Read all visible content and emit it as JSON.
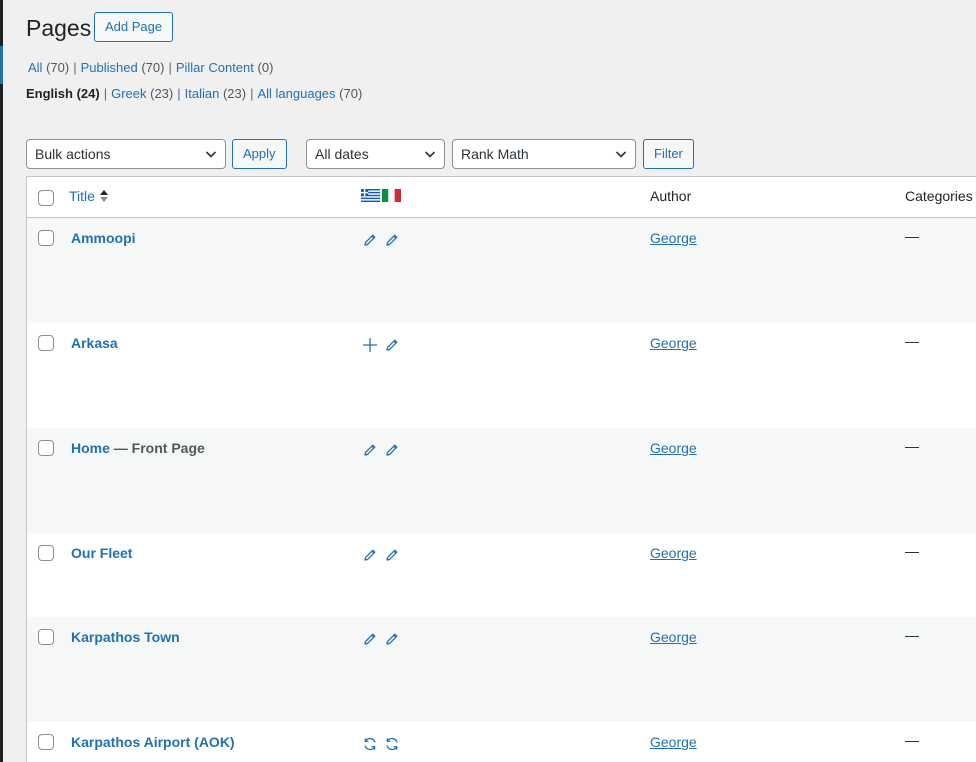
{
  "header": {
    "title": "Pages",
    "add_button": "Add Page"
  },
  "status_links": [
    {
      "label": "All",
      "count": "(70)"
    },
    {
      "label": "Published",
      "count": "(70)"
    },
    {
      "label": "Pillar Content",
      "count": "(0)"
    }
  ],
  "language_links": [
    {
      "label": "English",
      "count": "(24)",
      "current": true
    },
    {
      "label": "Greek",
      "count": "(23)"
    },
    {
      "label": "Italian",
      "count": "(23)"
    },
    {
      "label": "All languages",
      "count": "(70)"
    }
  ],
  "tablenav": {
    "bulk_actions": "Bulk actions",
    "apply": "Apply",
    "dates": "All dates",
    "seo": "Rank Math",
    "filter": "Filter"
  },
  "columns": {
    "title": "Title",
    "flag_greek": "greek-flag-icon",
    "flag_italian": "italian-flag-icon",
    "author": "Author",
    "categories": "Categories"
  },
  "rows": [
    {
      "title": "Ammoopi",
      "state": "",
      "greek": "pencil-icon",
      "italian": "pencil-icon",
      "author": "George",
      "categories": "—"
    },
    {
      "title": "Arkasa",
      "state": "",
      "greek": "plus-icon",
      "italian": "pencil-icon",
      "author": "George",
      "categories": "—"
    },
    {
      "title": "Home",
      "state": " — Front Page",
      "greek": "pencil-icon",
      "italian": "pencil-icon",
      "author": "George",
      "categories": "—"
    },
    {
      "title": "Our Fleet",
      "state": "",
      "greek": "pencil-icon",
      "italian": "pencil-icon",
      "author": "George",
      "categories": "—"
    },
    {
      "title": "Karpathos Town",
      "state": "",
      "greek": "pencil-icon",
      "italian": "pencil-icon",
      "author": "George",
      "categories": "—"
    },
    {
      "title": "Karpathos Airport (AOK)",
      "state": "",
      "greek": "sync-icon",
      "italian": "sync-icon",
      "author": "George",
      "categories": "—"
    }
  ],
  "colors": {
    "link": "#2271b1",
    "background": "#f0f0f1",
    "admin_bar": "#1d2327"
  }
}
